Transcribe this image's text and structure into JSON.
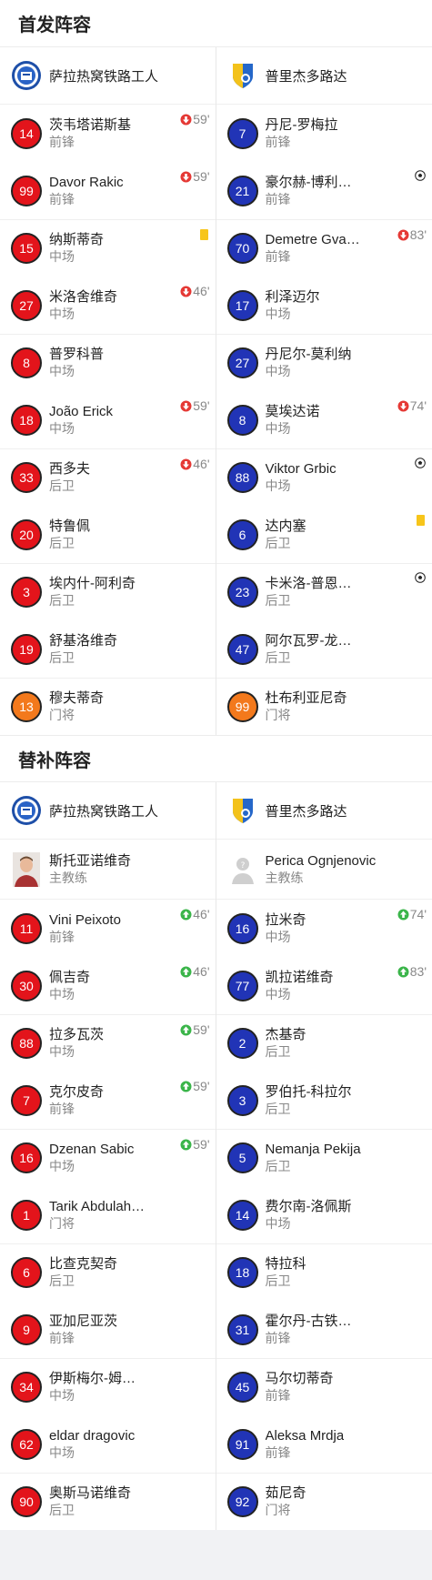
{
  "starting_title": "首发阵容",
  "subs_title": "替补阵容",
  "home_team": "萨拉热窝铁路工人",
  "away_team": "普里杰多路达",
  "starting": {
    "home": [
      {
        "number": "14",
        "name": "茨韦塔诺斯基",
        "position": "前锋",
        "color": "red",
        "event": {
          "type": "sub_out",
          "minute": "59'"
        }
      },
      {
        "number": "99",
        "name": "Davor Rakic",
        "position": "前锋",
        "color": "red",
        "event": {
          "type": "sub_out",
          "minute": "59'"
        }
      },
      {
        "number": "15",
        "name": "纳斯蒂奇",
        "position": "中场",
        "color": "red",
        "event": {
          "type": "yellow_card"
        }
      },
      {
        "number": "27",
        "name": "米洛舍维奇",
        "position": "中场",
        "color": "red",
        "event": {
          "type": "sub_out",
          "minute": "46'"
        }
      },
      {
        "number": "8",
        "name": "普罗科普",
        "position": "中场",
        "color": "red",
        "event": null
      },
      {
        "number": "18",
        "name": "João Erick",
        "position": "中场",
        "color": "red",
        "event": {
          "type": "sub_out",
          "minute": "59'"
        }
      },
      {
        "number": "33",
        "name": "西多夫",
        "position": "后卫",
        "color": "red",
        "event": {
          "type": "sub_out",
          "minute": "46'"
        }
      },
      {
        "number": "20",
        "name": "特鲁佩",
        "position": "后卫",
        "color": "red",
        "event": null
      },
      {
        "number": "3",
        "name": "埃内什-阿利奇",
        "position": "后卫",
        "color": "red",
        "event": null
      },
      {
        "number": "19",
        "name": "舒基洛维奇",
        "position": "后卫",
        "color": "red",
        "event": null
      },
      {
        "number": "13",
        "name": "穆夫蒂奇",
        "position": "门将",
        "color": "orange",
        "event": null
      }
    ],
    "away": [
      {
        "number": "7",
        "name": "丹尼-罗梅拉",
        "position": "前锋",
        "color": "blue",
        "event": null
      },
      {
        "number": "21",
        "name": "豪尔赫-博利…",
        "position": "前锋",
        "color": "blue",
        "event": {
          "type": "goal"
        }
      },
      {
        "number": "70",
        "name": "Demetre Gva…",
        "position": "前锋",
        "color": "blue",
        "event": {
          "type": "sub_out",
          "minute": "83'"
        }
      },
      {
        "number": "17",
        "name": "利泽迈尔",
        "position": "中场",
        "color": "blue",
        "event": null
      },
      {
        "number": "27",
        "name": "丹尼尔-莫利纳",
        "position": "中场",
        "color": "blue",
        "event": null
      },
      {
        "number": "8",
        "name": "莫埃达诺",
        "position": "中场",
        "color": "blue",
        "event": {
          "type": "sub_out",
          "minute": "74'"
        }
      },
      {
        "number": "88",
        "name": "Viktor Grbic",
        "position": "中场",
        "color": "blue",
        "event": {
          "type": "goal"
        }
      },
      {
        "number": "6",
        "name": "达内塞",
        "position": "后卫",
        "color": "blue",
        "event": {
          "type": "yellow_card"
        }
      },
      {
        "number": "23",
        "name": "卡米洛-普恩…",
        "position": "后卫",
        "color": "blue",
        "event": {
          "type": "goal"
        }
      },
      {
        "number": "47",
        "name": "阿尔瓦罗-龙…",
        "position": "后卫",
        "color": "blue",
        "event": null
      },
      {
        "number": "99",
        "name": "杜布利亚尼奇",
        "position": "门将",
        "color": "orange",
        "event": null
      }
    ]
  },
  "coaches": {
    "home": {
      "name": "斯托亚诺维奇",
      "role": "主教练"
    },
    "away": {
      "name": "Perica Ognjenovic",
      "role": "主教练"
    }
  },
  "subs": {
    "home": [
      {
        "number": "11",
        "name": "Vini Peixoto",
        "position": "前锋",
        "color": "red",
        "event": {
          "type": "sub_in",
          "minute": "46'"
        }
      },
      {
        "number": "30",
        "name": "佩吉奇",
        "position": "中场",
        "color": "red",
        "event": {
          "type": "sub_in",
          "minute": "46'"
        }
      },
      {
        "number": "88",
        "name": "拉多瓦茨",
        "position": "中场",
        "color": "red",
        "event": {
          "type": "sub_in",
          "minute": "59'"
        }
      },
      {
        "number": "7",
        "name": "克尔皮奇",
        "position": "前锋",
        "color": "red",
        "event": {
          "type": "sub_in",
          "minute": "59'"
        }
      },
      {
        "number": "16",
        "name": "Dzenan Sabic",
        "position": "中场",
        "color": "red",
        "event": {
          "type": "sub_in",
          "minute": "59'"
        }
      },
      {
        "number": "1",
        "name": "Tarik Abdulah…",
        "position": "门将",
        "color": "red",
        "event": null
      },
      {
        "number": "6",
        "name": "比查克契奇",
        "position": "后卫",
        "color": "red",
        "event": null
      },
      {
        "number": "9",
        "name": "亚加尼亚茨",
        "position": "前锋",
        "color": "red",
        "event": null
      },
      {
        "number": "34",
        "name": "伊斯梅尔-姆…",
        "position": "中场",
        "color": "red",
        "event": null
      },
      {
        "number": "62",
        "name": "eldar dragovic",
        "position": "中场",
        "color": "red",
        "event": null
      },
      {
        "number": "90",
        "name": "奥斯马诺维奇",
        "position": "后卫",
        "color": "red",
        "event": null
      }
    ],
    "away": [
      {
        "number": "16",
        "name": "拉米奇",
        "position": "中场",
        "color": "blue",
        "event": {
          "type": "sub_in",
          "minute": "74'"
        }
      },
      {
        "number": "77",
        "name": "凯拉诺维奇",
        "position": "中场",
        "color": "blue",
        "event": {
          "type": "sub_in",
          "minute": "83'"
        }
      },
      {
        "number": "2",
        "name": "杰基奇",
        "position": "后卫",
        "color": "blue",
        "event": null
      },
      {
        "number": "3",
        "name": "罗伯托-科拉尔",
        "position": "后卫",
        "color": "blue",
        "event": null
      },
      {
        "number": "5",
        "name": "Nemanja Pekija",
        "position": "后卫",
        "color": "blue",
        "event": null
      },
      {
        "number": "14",
        "name": "费尔南-洛佩斯",
        "position": "中场",
        "color": "blue",
        "event": null
      },
      {
        "number": "18",
        "name": "特拉科",
        "position": "后卫",
        "color": "blue",
        "event": null
      },
      {
        "number": "31",
        "name": "霍尔丹-古铁…",
        "position": "前锋",
        "color": "blue",
        "event": null
      },
      {
        "number": "45",
        "name": "马尔切蒂奇",
        "position": "前锋",
        "color": "blue",
        "event": null
      },
      {
        "number": "91",
        "name": "Aleksa Mrdja",
        "position": "前锋",
        "color": "blue",
        "event": null
      },
      {
        "number": "92",
        "name": "茹尼奇",
        "position": "门将",
        "color": "blue",
        "event": null
      }
    ]
  },
  "colors": {
    "red": "#e3141b",
    "blue": "#2134b6",
    "orange": "#f3791c",
    "sub_out": "#e53935",
    "sub_in": "#3bb54a",
    "yellow": "#f7c51a"
  }
}
